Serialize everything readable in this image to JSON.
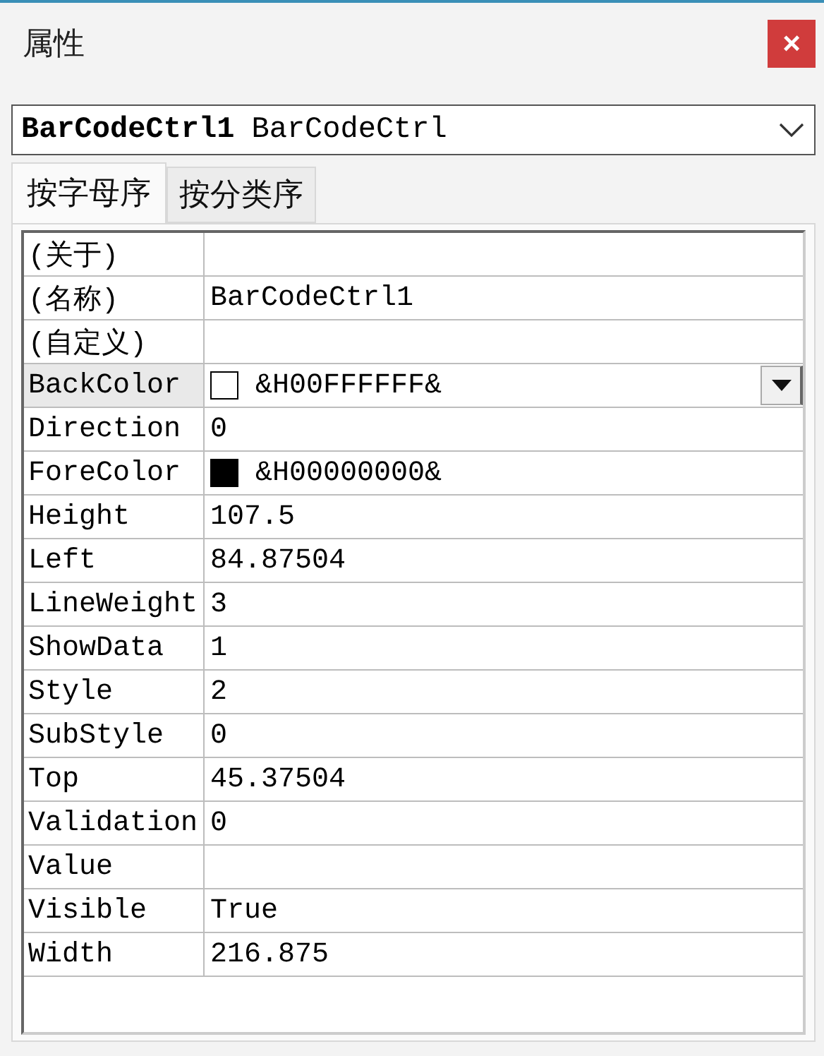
{
  "window": {
    "title": "属性",
    "close_label": "×"
  },
  "object_selector": {
    "name": "BarCodeCtrl1",
    "type": "BarCodeCtrl"
  },
  "tabs": [
    {
      "label": "按字母序",
      "selected": true
    },
    {
      "label": "按分类序",
      "selected": false
    }
  ],
  "properties": [
    {
      "name": "(关于)",
      "kind": "text",
      "selected": false
    },
    {
      "name": "(名称)",
      "value": "BarCodeCtrl1",
      "kind": "text",
      "selected": false
    },
    {
      "name": "(自定义)",
      "kind": "text",
      "selected": false
    },
    {
      "name": "BackColor",
      "value": "&H00FFFFFF&",
      "kind": "color",
      "color": "#ffffff",
      "selected": true
    },
    {
      "name": "Direction",
      "value": "0",
      "kind": "text",
      "selected": false
    },
    {
      "name": "ForeColor",
      "value": "&H00000000&",
      "kind": "color",
      "color": "#000000",
      "selected": false
    },
    {
      "name": "Height",
      "value": "107.5",
      "kind": "text",
      "selected": false
    },
    {
      "name": "Left",
      "value": "84.87504",
      "kind": "text",
      "selected": false
    },
    {
      "name": "LineWeight",
      "value": "3",
      "kind": "text",
      "selected": false
    },
    {
      "name": "ShowData",
      "value": "1",
      "kind": "text",
      "selected": false
    },
    {
      "name": "Style",
      "value": "2",
      "kind": "text",
      "selected": false
    },
    {
      "name": "SubStyle",
      "value": "0",
      "kind": "text",
      "selected": false
    },
    {
      "name": "Top",
      "value": "45.37504",
      "kind": "text",
      "selected": false
    },
    {
      "name": "Validation",
      "value": "0",
      "kind": "text",
      "selected": false
    },
    {
      "name": "Value",
      "kind": "text",
      "selected": false
    },
    {
      "name": "Visible",
      "value": "True",
      "kind": "text",
      "selected": false
    },
    {
      "name": "Width",
      "value": "216.875",
      "kind": "text",
      "selected": false
    }
  ]
}
